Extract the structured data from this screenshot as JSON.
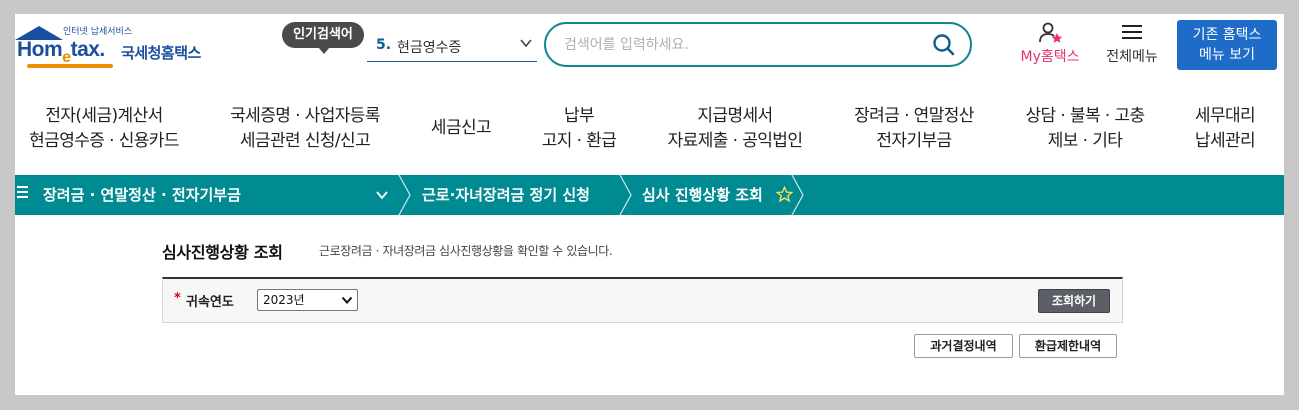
{
  "header": {
    "logo": {
      "small_text": "인터넷 납세서비스",
      "brand": "Hom",
      "brand_e": "e",
      "brand_tail": "tax.",
      "korean_name": "국세청홈택스"
    },
    "popular_search": {
      "badge": "인기검색어",
      "rank": "5.",
      "term": "현금영수증"
    },
    "search": {
      "placeholder": "검색어를 입력하세요."
    },
    "my_hometax_label": "My홈택스",
    "all_menu_label": "전체메뉴",
    "old_home_button": {
      "line1": "기존 홈택스",
      "line2": "메뉴 보기"
    }
  },
  "gnb": [
    {
      "line1": "전자(세금)계산서",
      "line2": "현금영수증 · 신용카드"
    },
    {
      "line1": "국세증명 · 사업자등록",
      "line2": "세금관련 신청/신고"
    },
    {
      "line1": "세금신고",
      "line2": ""
    },
    {
      "line1": "납부",
      "line2": "고지 · 환급"
    },
    {
      "line1": "지급명세서",
      "line2": "자료제출 · 공익법인"
    },
    {
      "line1": "장려금 · 연말정산",
      "line2": "전자기부금"
    },
    {
      "line1": "상담 · 불복 · 고충",
      "line2": "제보 · 기타"
    },
    {
      "line1": "세무대리",
      "line2": "납세관리"
    }
  ],
  "location": {
    "menu_glyph": "≡",
    "level1": "장려금 · 연말정산 · 전자기부금",
    "level2": "근로·자녀장려금 정기 신청",
    "level3": "심사 진행상황 조회"
  },
  "content": {
    "title": "심사진행상황 조회",
    "description": "근로장려금 · 자녀장려금 심사진행상황을 확인할 수 있습니다.",
    "form": {
      "required_mark": "*",
      "year_label": "귀속연도",
      "year_value": "2023년",
      "query_button": "조회하기"
    },
    "buttons": {
      "past_decisions": "과거결정내역",
      "refund_limit": "환급제한내역"
    }
  },
  "colors": {
    "brand_blue": "#1a4fa0",
    "brand_orange": "#f08c00",
    "teal": "#008a91",
    "search_border": "#12878f",
    "my_pink": "#e6336e",
    "old_home_blue": "#1e6cc8"
  }
}
